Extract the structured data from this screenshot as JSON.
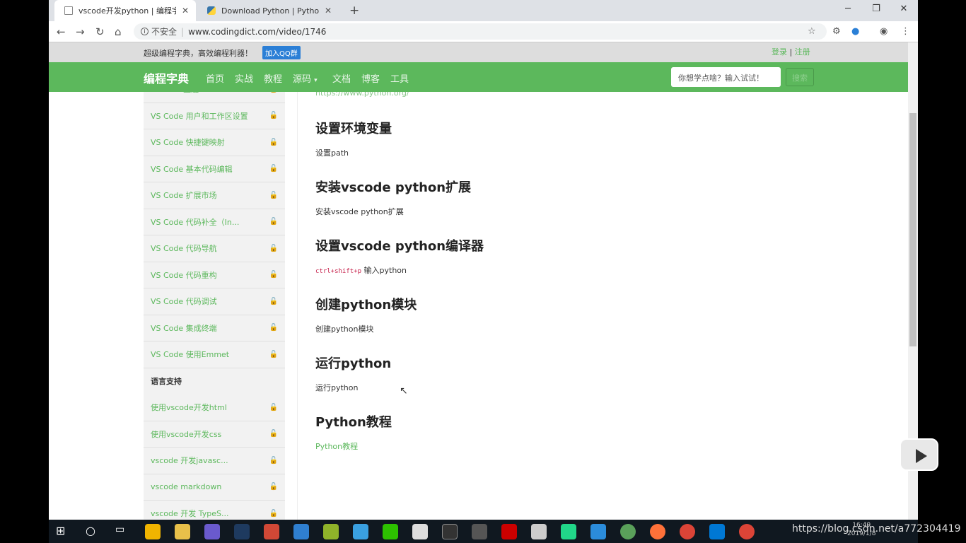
{
  "browser": {
    "tabs": [
      {
        "title": "vscode开发python | 编程字典",
        "close": "✕"
      },
      {
        "title": "Download Python | Python.org",
        "close": "✕"
      }
    ],
    "new_tab": "+",
    "window_buttons": {
      "minimize": "─",
      "restore": "❐",
      "close": "✕"
    },
    "nav": {
      "back": "←",
      "forward": "→",
      "reload": "↻",
      "home": "⌂"
    },
    "address": {
      "security": "不安全",
      "separator": "|",
      "url": "www.codingdict.com/video/1746"
    }
  },
  "site": {
    "slogan": "超级编程字典，高效编程利器！",
    "qq_button": "加入QQ群",
    "login": "登录",
    "auth_sep": "|",
    "register": "注册",
    "brand": "编程字典",
    "nav": [
      "首页",
      "实战",
      "教程",
      "源码",
      "文档",
      "博客",
      "工具"
    ],
    "search_placeholder": "你想学点啥？输入试试！",
    "search_button": "搜索"
  },
  "sidebar": {
    "items_top": [
      "VS Code主题",
      "VS Code 用户和工作区设置",
      "VS Code 快捷键映射",
      "VS Code 基本代码编辑",
      "VS Code 扩展市场",
      "VS Code 代码补全（In...",
      "VS Code 代码导航",
      "VS Code 代码重构",
      "VS Code 代码调试",
      "VS Code 集成终端",
      "VS Code 使用Emmet"
    ],
    "section": "语言支持",
    "items_bottom": [
      "使用vscode开发html",
      "使用vscode开发css",
      "vscode 开发javasc...",
      "vscode markdown",
      "vscode 开发 TypeS..."
    ],
    "lock": "🔓"
  },
  "content": {
    "top_link": "https://www.python.org/",
    "sections": [
      {
        "heading": "设置环境变量",
        "text": "设置path"
      },
      {
        "heading": "安装vscode python扩展",
        "text": "安装vscode python扩展"
      },
      {
        "heading": "设置vscode python编译器",
        "code": "ctrl+shift+p",
        "text": " 输入python"
      },
      {
        "heading": "创建python模块",
        "text": "创建python模块"
      },
      {
        "heading": "运行python",
        "text": "运行python"
      },
      {
        "heading": "Python教程",
        "link": "Python教程"
      }
    ]
  },
  "taskbar": {
    "watermark": "https://blog.csdn.net/a772304419",
    "time": "16:49",
    "date": "2019/1/8"
  },
  "colors": {
    "accent": "#5cb85c",
    "code": "#c7254e",
    "tabbar": "#dee1e6"
  }
}
